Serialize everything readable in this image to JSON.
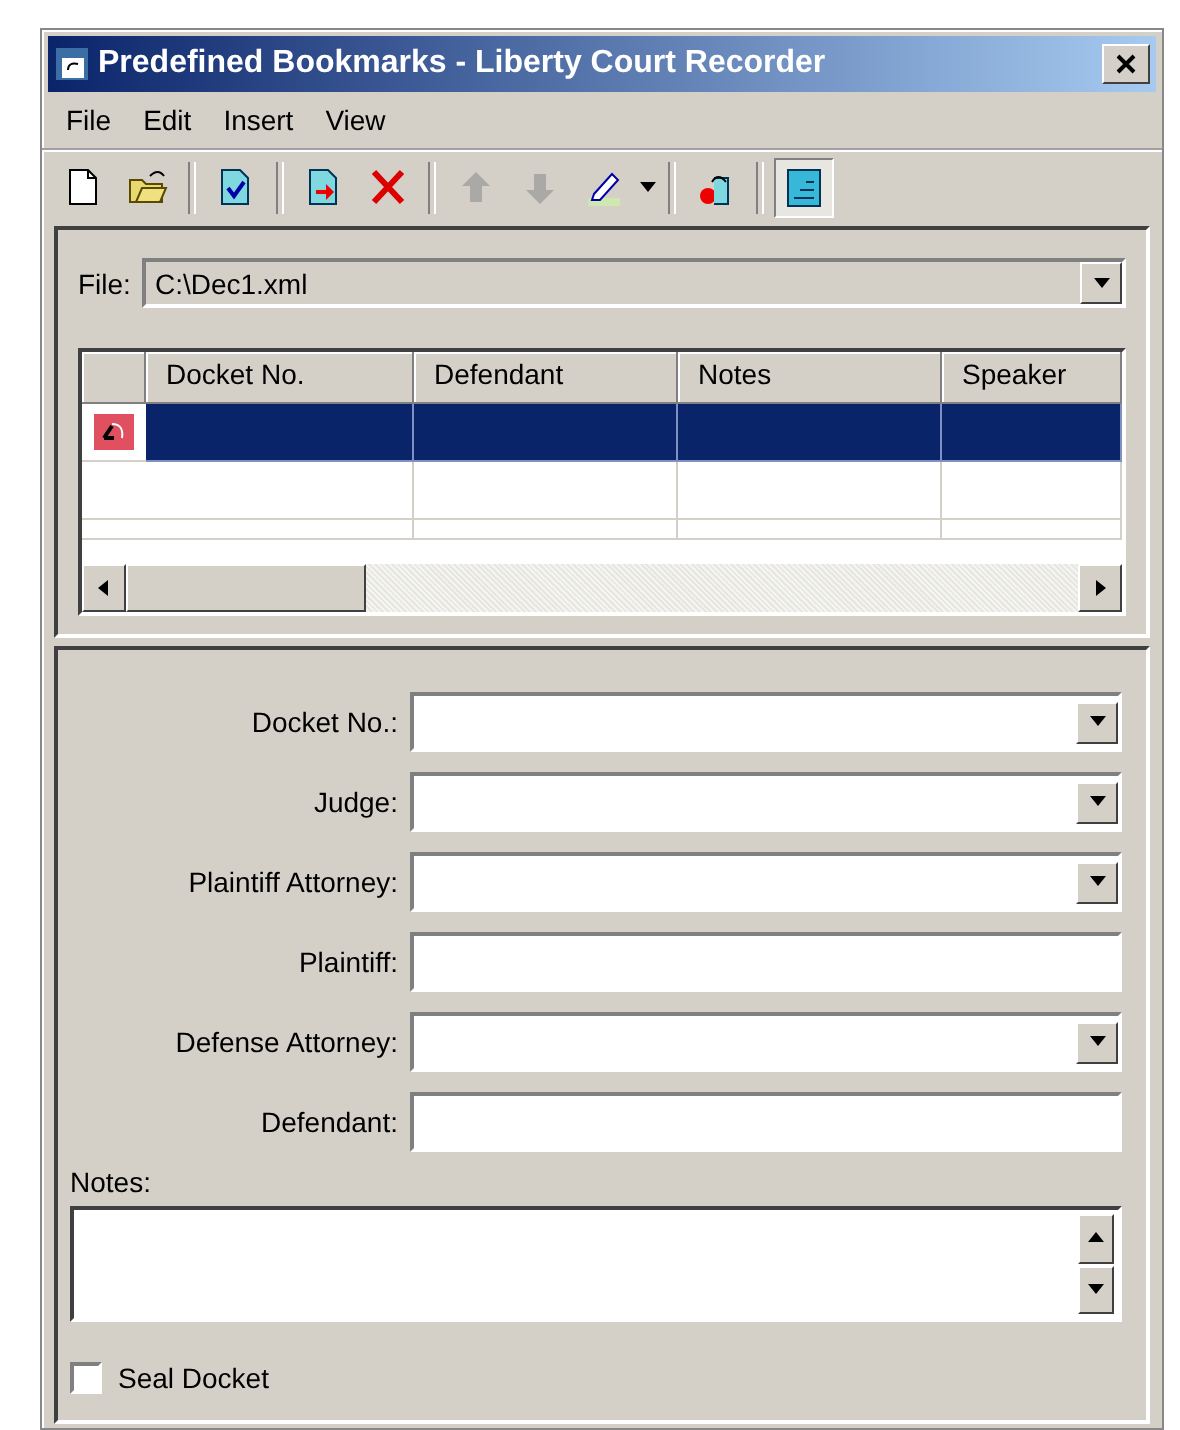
{
  "window": {
    "title": "Predefined Bookmarks - Liberty Court Recorder"
  },
  "menu": [
    "File",
    "Edit",
    "Insert",
    "View"
  ],
  "toolbar": [
    {
      "disabled": false,
      "pressed": false
    },
    {
      "disabled": false,
      "pressed": false
    },
    {
      "disabled": false,
      "pressed": false
    },
    {
      "disabled": false,
      "pressed": false
    },
    {
      "disabled": false,
      "pressed": false
    },
    {
      "disabled": true,
      "pressed": false
    },
    {
      "disabled": true,
      "pressed": false
    },
    {
      "disabled": false,
      "pressed": false
    },
    {
      "disabled": false,
      "pressed": false
    },
    {
      "disabled": false,
      "pressed": true
    }
  ],
  "file": {
    "label": "File:",
    "value": "C:\\Dec1.xml"
  },
  "table": {
    "columns": [
      "Docket No.",
      "Defendant",
      "Notes",
      "Speaker"
    ],
    "rows": [
      {
        "selected": true
      },
      {
        "selected": false
      },
      {
        "selected": false
      }
    ]
  },
  "form": [
    {
      "label": "Docket No.:",
      "kind": "combo"
    },
    {
      "label": "Judge:",
      "kind": "combo"
    },
    {
      "label": "Plaintiff Attorney:",
      "kind": "combo"
    },
    {
      "label": "Plaintiff:",
      "kind": "text"
    },
    {
      "label": "Defense Attorney:",
      "kind": "combo"
    },
    {
      "label": "Defendant:",
      "kind": "text"
    }
  ],
  "notes": {
    "label": "Notes:"
  },
  "seal": {
    "label": "Seal Docket",
    "checked": false
  }
}
